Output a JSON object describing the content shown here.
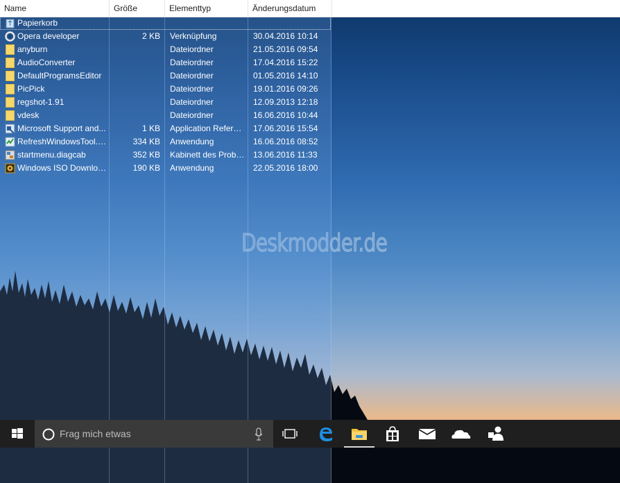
{
  "header": {
    "columns": [
      "Name",
      "Größe",
      "Elementtyp",
      "Änderungsdatum"
    ]
  },
  "files": [
    {
      "name": "Papierkorb",
      "size": "",
      "type": "",
      "date": "",
      "icon": "recycle-bin-icon"
    },
    {
      "name": "Opera developer",
      "size": "2 KB",
      "type": "Verknüpfung",
      "date": "30.04.2016 10:14",
      "icon": "opera-icon"
    },
    {
      "name": "anyburn",
      "size": "",
      "type": "Dateiordner",
      "date": "21.05.2016 09:54",
      "icon": "folder-icon"
    },
    {
      "name": "AudioConverter",
      "size": "",
      "type": "Dateiordner",
      "date": "17.04.2016 15:22",
      "icon": "folder-icon"
    },
    {
      "name": "DefaultProgramsEditor",
      "size": "",
      "type": "Dateiordner",
      "date": "01.05.2016 14:10",
      "icon": "folder-icon"
    },
    {
      "name": "PicPick",
      "size": "",
      "type": "Dateiordner",
      "date": "19.01.2016 09:26",
      "icon": "folder-icon"
    },
    {
      "name": "regshot-1.91",
      "size": "",
      "type": "Dateiordner",
      "date": "12.09.2013 12:18",
      "icon": "folder-icon"
    },
    {
      "name": "vdesk",
      "size": "",
      "type": "Dateiordner",
      "date": "16.06.2016 10:44",
      "icon": "folder-icon"
    },
    {
      "name": "Microsoft Support and...",
      "size": "1 KB",
      "type": "Application Refere...",
      "date": "17.06.2016 15:54",
      "icon": "application-reference-icon"
    },
    {
      "name": "RefreshWindowsTool.e...",
      "size": "334 KB",
      "type": "Anwendung",
      "date": "16.06.2016 08:52",
      "icon": "refresh-tool-icon"
    },
    {
      "name": "startmenu.diagcab",
      "size": "352 KB",
      "type": "Kabinett des Probl...",
      "date": "13.06.2016 11:33",
      "icon": "diagcab-icon"
    },
    {
      "name": "Windows ISO Downloa...",
      "size": "190 KB",
      "type": "Anwendung",
      "date": "22.05.2016 18:00",
      "icon": "iso-downloader-icon"
    }
  ],
  "watermark": "Deskmodder.de",
  "taskbar": {
    "search_placeholder": "Frag mich etwas",
    "buttons": [
      "start-icon",
      "task-view-icon",
      "edge-icon",
      "file-explorer-icon",
      "store-icon",
      "mail-icon",
      "onedrive-icon",
      "people-icon"
    ]
  },
  "colors": {
    "taskbar": "#1f1f1f",
    "searchbox": "#3a3a3a",
    "selection": "#78aae6",
    "folder": "#f5d76e",
    "edge_blue": "#1e8fe0"
  }
}
